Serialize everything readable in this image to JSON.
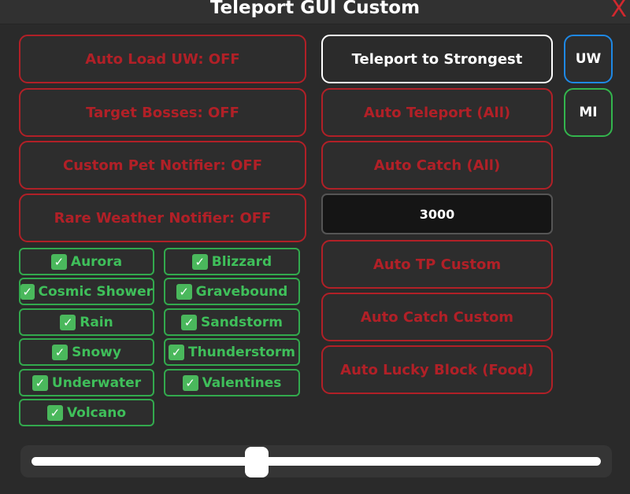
{
  "window": {
    "title": "Teleport GUI Custom",
    "close_label": "X"
  },
  "left_buttons": [
    "Auto Load UW: OFF",
    "Target Bosses: OFF",
    "Custom Pet Notifier: OFF",
    "Rare Weather Notifier: OFF"
  ],
  "right_buttons": {
    "teleport_strongest": "Teleport to Strongest",
    "auto_teleport_all": "Auto Teleport (All)",
    "auto_catch_all": "Auto Catch (All)",
    "amount_value": "3000",
    "auto_tp_custom": "Auto TP Custom",
    "auto_catch_custom": "Auto Catch Custom",
    "auto_lucky_block": "Auto Lucky Block (Food)"
  },
  "side_buttons": {
    "uw": "UW",
    "mi": "MI"
  },
  "weather_checks": {
    "checkmark": "✓",
    "items": [
      "Aurora",
      "Blizzard",
      "Cosmic Shower",
      "Gravebound",
      "Rain",
      "Sandstorm",
      "Snowy",
      "Thunderstorm",
      "Underwater",
      "Valentines",
      "Volcano"
    ]
  },
  "slider": {
    "value": 0.395
  },
  "colors": {
    "accent_red": "#b12027",
    "check_green": "#32a94d",
    "uw_blue": "#1e88e5"
  }
}
